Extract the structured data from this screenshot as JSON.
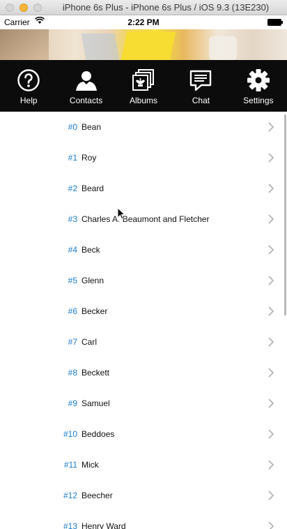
{
  "window": {
    "title": "iPhone 6s Plus - iPhone 6s Plus / iOS 9.3 (13E230)"
  },
  "status_bar": {
    "carrier": "Carrier",
    "time": "2:22 PM"
  },
  "toolbar": {
    "items": [
      {
        "label": "Help",
        "icon": "help-icon"
      },
      {
        "label": "Contacts",
        "icon": "contacts-icon"
      },
      {
        "label": "Albums",
        "icon": "albums-icon"
      },
      {
        "label": "Chat",
        "icon": "chat-icon"
      },
      {
        "label": "Settings",
        "icon": "settings-icon"
      }
    ]
  },
  "list": {
    "items": [
      {
        "number": "#0",
        "name": "Bean"
      },
      {
        "number": "#1",
        "name": "Roy"
      },
      {
        "number": "#2",
        "name": "Beard"
      },
      {
        "number": "#3",
        "name": "Charles A. Beaumont and Fletcher"
      },
      {
        "number": "#4",
        "name": "Beck"
      },
      {
        "number": "#5",
        "name": "Glenn"
      },
      {
        "number": "#6",
        "name": "Becker"
      },
      {
        "number": "#7",
        "name": "Carl"
      },
      {
        "number": "#8",
        "name": "Beckett"
      },
      {
        "number": "#9",
        "name": "Samuel"
      },
      {
        "number": "#10",
        "name": "Beddoes"
      },
      {
        "number": "#11",
        "name": "Mick"
      },
      {
        "number": "#12",
        "name": "Beecher"
      },
      {
        "number": "#13",
        "name": "Henry Ward"
      }
    ]
  },
  "colors": {
    "accent": "#1e7bc8",
    "toolbar_bg": "#0c0c0c"
  }
}
